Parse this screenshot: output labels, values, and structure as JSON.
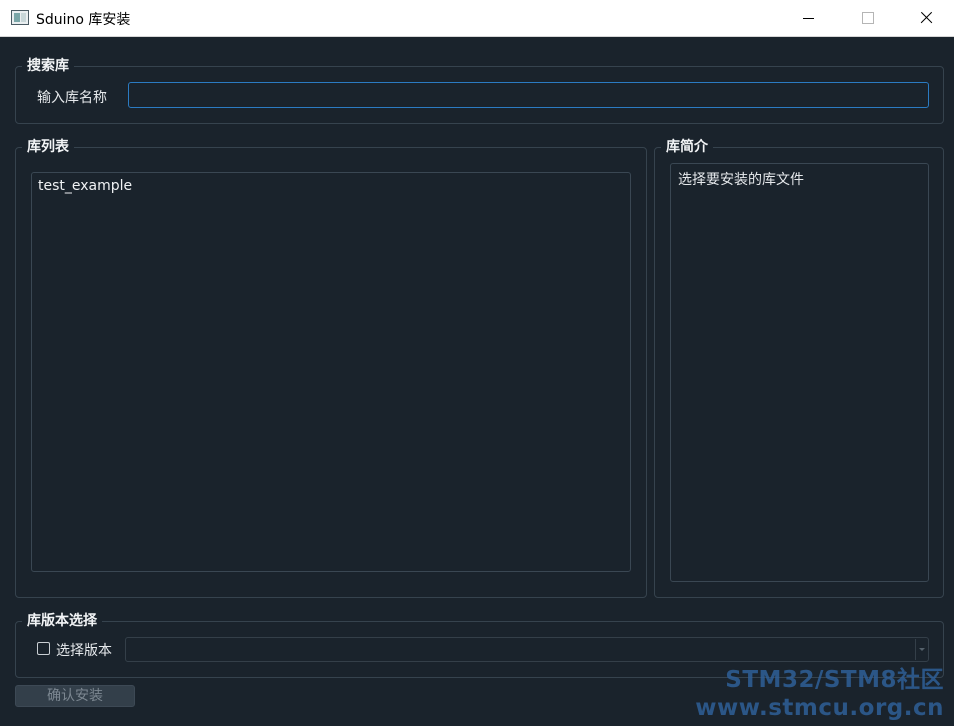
{
  "window": {
    "title": "Sduino 库安装"
  },
  "search_group": {
    "title": "搜索库",
    "label": "输入库名称",
    "input_value": "",
    "input_placeholder": ""
  },
  "list_group": {
    "title": "库列表",
    "items": [
      "test_example"
    ]
  },
  "intro_group": {
    "title": "库简介",
    "text": "选择要安装的库文件"
  },
  "version_group": {
    "title": "库版本选择",
    "checkbox_label": "选择版本",
    "checked": false,
    "selected_value": ""
  },
  "actions": {
    "confirm_label": "确认安装"
  },
  "watermark": {
    "line1": "STM32/STM8社区",
    "line2": "www.stmcu.org.cn"
  },
  "colors": {
    "background": "#1a232c",
    "accent_border": "#2b7bc2",
    "group_border": "#36434e",
    "watermark": "#2f5f97"
  }
}
